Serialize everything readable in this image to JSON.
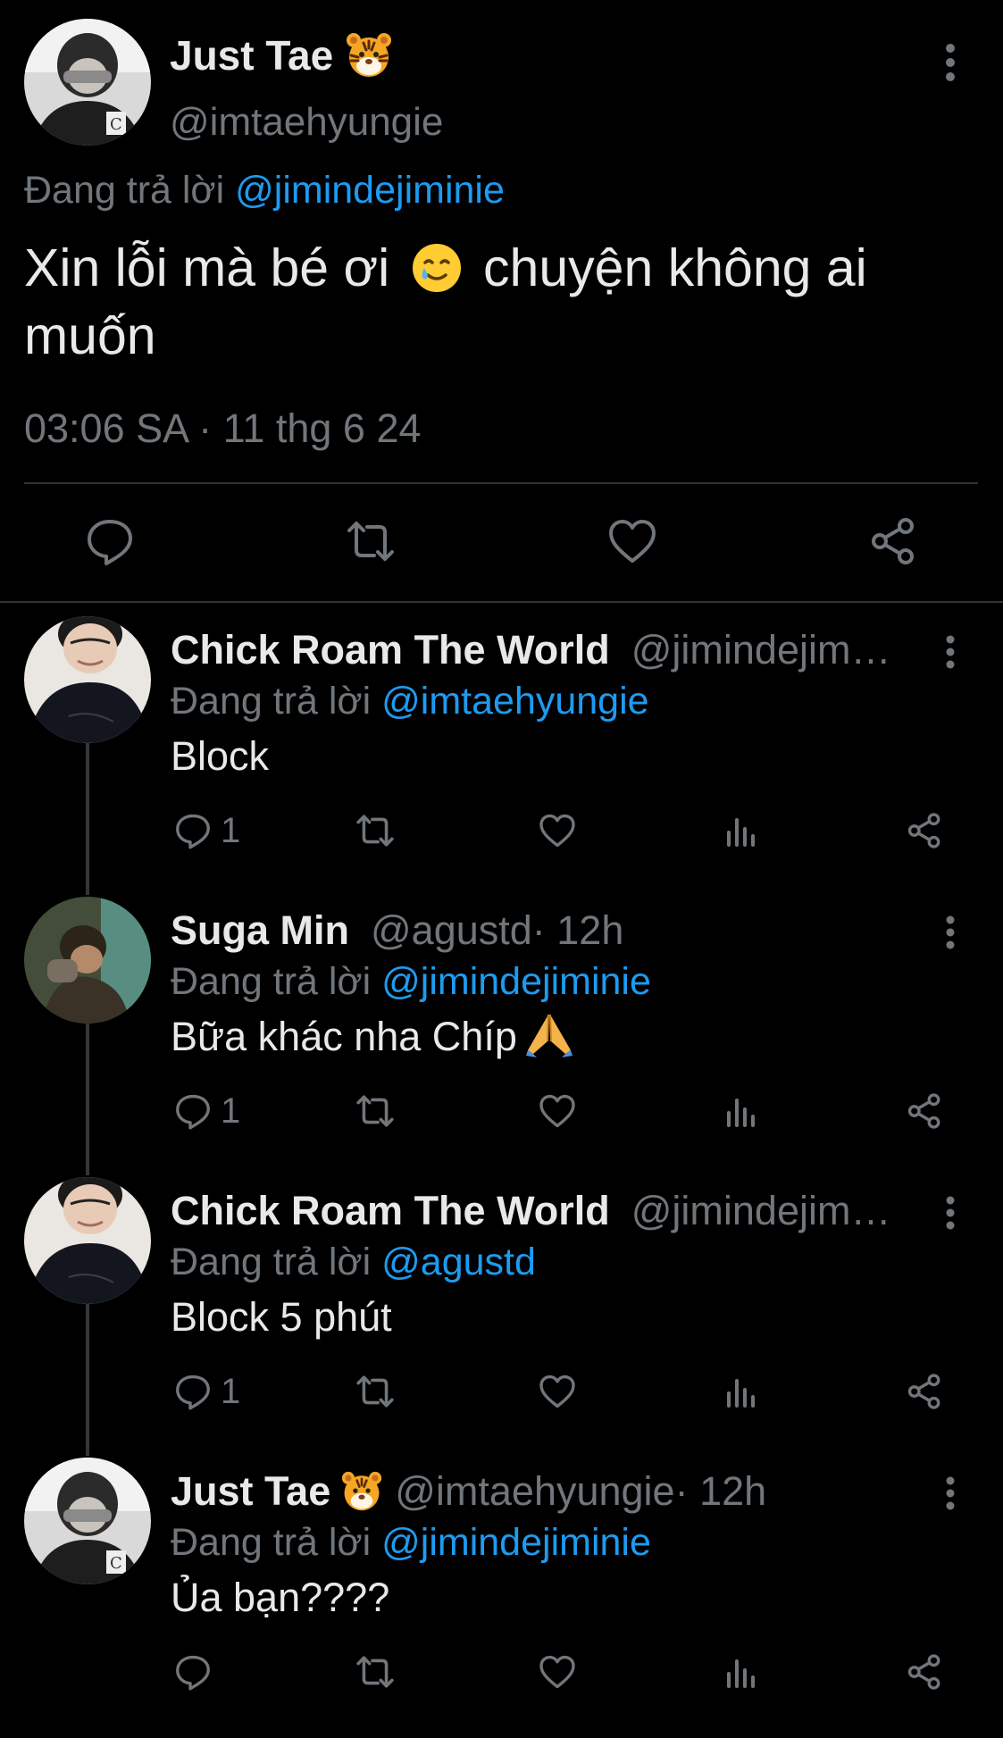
{
  "main_tweet": {
    "display_name": "Just Tae",
    "name_emoji": "tiger-face-icon",
    "handle": "@imtaehyungie",
    "replying_prefix": "Đang trả lời",
    "replying_to": "@jimindejiminie",
    "text_before_emoji": "Xin lỗi mà bé ơi",
    "text_emoji": "smiling-face-with-tear-icon",
    "text_after_emoji": "chuyện không ai muốn",
    "timestamp": "03:06 SA · 11 thg 6 24",
    "actions": [
      "reply-icon",
      "retweet-icon",
      "like-icon",
      "share-icon"
    ]
  },
  "replies": [
    {
      "display_name": "Chick Roam The World",
      "name_emoji": "",
      "handle": "@jimindejim…",
      "time": "",
      "replying_prefix": "Đang trả lời",
      "replying_to": "@imtaehyungie",
      "text": "Block",
      "text_emoji": "",
      "reply_count": "1"
    },
    {
      "display_name": "Suga Min",
      "name_emoji": "",
      "handle": "@agustd",
      "time": " · 12h",
      "replying_prefix": "Đang trả lời",
      "replying_to": "@jimindejiminie",
      "text": "Bữa khác nha Chíp",
      "text_emoji": "folded-hands-icon",
      "reply_count": "1"
    },
    {
      "display_name": "Chick Roam The World",
      "name_emoji": "",
      "handle": "@jimindejim…",
      "time": "",
      "replying_prefix": "Đang trả lời",
      "replying_to": "@agustd",
      "text": "Block 5 phút",
      "text_emoji": "",
      "reply_count": "1"
    },
    {
      "display_name": "Just Tae",
      "name_emoji": "tiger-face-icon",
      "handle": "@imtaehyungie",
      "time": " · 12h",
      "replying_prefix": "Đang trả lời",
      "replying_to": "@jimindejiminie",
      "text": "Ủa bạn????",
      "text_emoji": "",
      "reply_count": ""
    }
  ],
  "colors": {
    "background": "#000000",
    "text_primary": "#e7e9ea",
    "text_secondary": "#71767b",
    "link": "#1d9bf0",
    "divider": "#2f3336"
  }
}
